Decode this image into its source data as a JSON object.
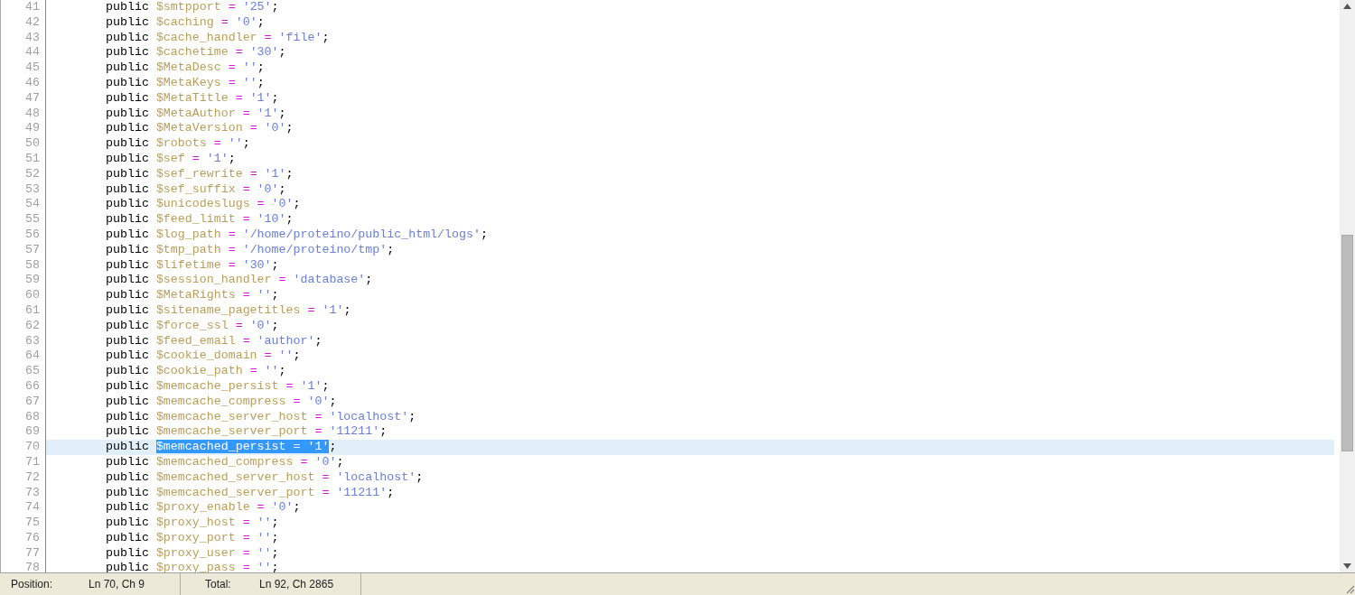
{
  "editor": {
    "lines": [
      {
        "number": "41",
        "keyword": "public",
        "variable": "$smtpport",
        "operator": "=",
        "value": "'25'",
        "end": ";",
        "current": false,
        "text_selected": false
      },
      {
        "number": "42",
        "keyword": "public",
        "variable": "$caching",
        "operator": "=",
        "value": "'0'",
        "end": ";",
        "current": false,
        "text_selected": false
      },
      {
        "number": "43",
        "keyword": "public",
        "variable": "$cache_handler",
        "operator": "=",
        "value": "'file'",
        "end": ";",
        "current": false,
        "text_selected": false
      },
      {
        "number": "44",
        "keyword": "public",
        "variable": "$cachetime",
        "operator": "=",
        "value": "'30'",
        "end": ";",
        "current": false,
        "text_selected": false
      },
      {
        "number": "45",
        "keyword": "public",
        "variable": "$MetaDesc",
        "operator": "=",
        "value": "''",
        "end": ";",
        "current": false,
        "text_selected": false
      },
      {
        "number": "46",
        "keyword": "public",
        "variable": "$MetaKeys",
        "operator": "=",
        "value": "''",
        "end": ";",
        "current": false,
        "text_selected": false
      },
      {
        "number": "47",
        "keyword": "public",
        "variable": "$MetaTitle",
        "operator": "=",
        "value": "'1'",
        "end": ";",
        "current": false,
        "text_selected": false
      },
      {
        "number": "48",
        "keyword": "public",
        "variable": "$MetaAuthor",
        "operator": "=",
        "value": "'1'",
        "end": ";",
        "current": false,
        "text_selected": false
      },
      {
        "number": "49",
        "keyword": "public",
        "variable": "$MetaVersion",
        "operator": "=",
        "value": "'0'",
        "end": ";",
        "current": false,
        "text_selected": false
      },
      {
        "number": "50",
        "keyword": "public",
        "variable": "$robots",
        "operator": "=",
        "value": "''",
        "end": ";",
        "current": false,
        "text_selected": false
      },
      {
        "number": "51",
        "keyword": "public",
        "variable": "$sef",
        "operator": "=",
        "value": "'1'",
        "end": ";",
        "current": false,
        "text_selected": false
      },
      {
        "number": "52",
        "keyword": "public",
        "variable": "$sef_rewrite",
        "operator": "=",
        "value": "'1'",
        "end": ";",
        "current": false,
        "text_selected": false
      },
      {
        "number": "53",
        "keyword": "public",
        "variable": "$sef_suffix",
        "operator": "=",
        "value": "'0'",
        "end": ";",
        "current": false,
        "text_selected": false
      },
      {
        "number": "54",
        "keyword": "public",
        "variable": "$unicodeslugs",
        "operator": "=",
        "value": "'0'",
        "end": ";",
        "current": false,
        "text_selected": false
      },
      {
        "number": "55",
        "keyword": "public",
        "variable": "$feed_limit",
        "operator": "=",
        "value": "'10'",
        "end": ";",
        "current": false,
        "text_selected": false
      },
      {
        "number": "56",
        "keyword": "public",
        "variable": "$log_path",
        "operator": "=",
        "value": "'/home/proteino/public_html/logs'",
        "end": ";",
        "current": false,
        "text_selected": false
      },
      {
        "number": "57",
        "keyword": "public",
        "variable": "$tmp_path",
        "operator": "=",
        "value": "'/home/proteino/tmp'",
        "end": ";",
        "current": false,
        "text_selected": false
      },
      {
        "number": "58",
        "keyword": "public",
        "variable": "$lifetime",
        "operator": "=",
        "value": "'30'",
        "end": ";",
        "current": false,
        "text_selected": false
      },
      {
        "number": "59",
        "keyword": "public",
        "variable": "$session_handler",
        "operator": "=",
        "value": "'database'",
        "end": ";",
        "current": false,
        "text_selected": false
      },
      {
        "number": "60",
        "keyword": "public",
        "variable": "$MetaRights",
        "operator": "=",
        "value": "''",
        "end": ";",
        "current": false,
        "text_selected": false
      },
      {
        "number": "61",
        "keyword": "public",
        "variable": "$sitename_pagetitles",
        "operator": "=",
        "value": "'1'",
        "end": ";",
        "current": false,
        "text_selected": false
      },
      {
        "number": "62",
        "keyword": "public",
        "variable": "$force_ssl",
        "operator": "=",
        "value": "'0'",
        "end": ";",
        "current": false,
        "text_selected": false
      },
      {
        "number": "63",
        "keyword": "public",
        "variable": "$feed_email",
        "operator": "=",
        "value": "'author'",
        "end": ";",
        "current": false,
        "text_selected": false
      },
      {
        "number": "64",
        "keyword": "public",
        "variable": "$cookie_domain",
        "operator": "=",
        "value": "''",
        "end": ";",
        "current": false,
        "text_selected": false
      },
      {
        "number": "65",
        "keyword": "public",
        "variable": "$cookie_path",
        "operator": "=",
        "value": "''",
        "end": ";",
        "current": false,
        "text_selected": false
      },
      {
        "number": "66",
        "keyword": "public",
        "variable": "$memcache_persist",
        "operator": "=",
        "value": "'1'",
        "end": ";",
        "current": false,
        "text_selected": false
      },
      {
        "number": "67",
        "keyword": "public",
        "variable": "$memcache_compress",
        "operator": "=",
        "value": "'0'",
        "end": ";",
        "current": false,
        "text_selected": false
      },
      {
        "number": "68",
        "keyword": "public",
        "variable": "$memcache_server_host",
        "operator": "=",
        "value": "'localhost'",
        "end": ";",
        "current": false,
        "text_selected": false
      },
      {
        "number": "69",
        "keyword": "public",
        "variable": "$memcache_server_port",
        "operator": "=",
        "value": "'11211'",
        "end": ";",
        "current": false,
        "text_selected": false
      },
      {
        "number": "70",
        "keyword": "public",
        "variable": "$memcached_persist",
        "operator": "=",
        "value": "'1'",
        "end": ";",
        "current": true,
        "text_selected": true
      },
      {
        "number": "71",
        "keyword": "public",
        "variable": "$memcached_compress",
        "operator": "=",
        "value": "'0'",
        "end": ";",
        "current": false,
        "text_selected": false
      },
      {
        "number": "72",
        "keyword": "public",
        "variable": "$memcached_server_host",
        "operator": "=",
        "value": "'localhost'",
        "end": ";",
        "current": false,
        "text_selected": false
      },
      {
        "number": "73",
        "keyword": "public",
        "variable": "$memcached_server_port",
        "operator": "=",
        "value": "'11211'",
        "end": ";",
        "current": false,
        "text_selected": false
      },
      {
        "number": "74",
        "keyword": "public",
        "variable": "$proxy_enable",
        "operator": "=",
        "value": "'0'",
        "end": ";",
        "current": false,
        "text_selected": false
      },
      {
        "number": "75",
        "keyword": "public",
        "variable": "$proxy_host",
        "operator": "=",
        "value": "''",
        "end": ";",
        "current": false,
        "text_selected": false
      },
      {
        "number": "76",
        "keyword": "public",
        "variable": "$proxy_port",
        "operator": "=",
        "value": "''",
        "end": ";",
        "current": false,
        "text_selected": false
      },
      {
        "number": "77",
        "keyword": "public",
        "variable": "$proxy_user",
        "operator": "=",
        "value": "''",
        "end": ";",
        "current": false,
        "text_selected": false
      },
      {
        "number": "78",
        "keyword": "public",
        "variable": "$proxy_pass",
        "operator": "=",
        "value": "''",
        "end": ";",
        "current": false,
        "text_selected": false
      }
    ]
  },
  "status_bar": {
    "fields": [
      {
        "label": "Position:",
        "value": "Ln 70, Ch 9"
      },
      {
        "label": "Total:",
        "value": "Ln 92, Ch 2865"
      }
    ]
  }
}
